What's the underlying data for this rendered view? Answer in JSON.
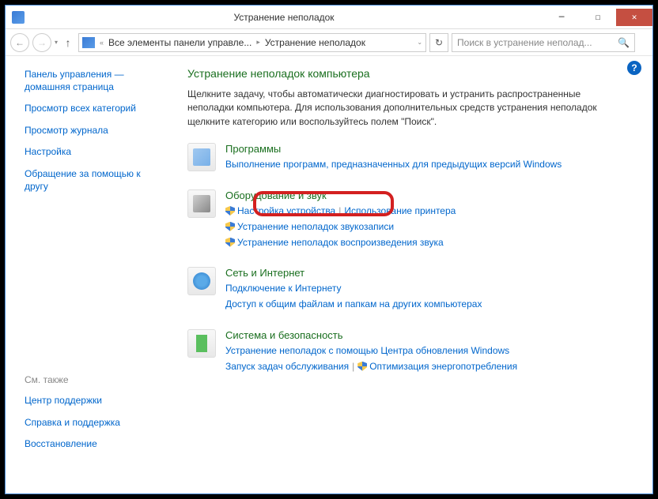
{
  "window": {
    "title": "Устранение неполадок"
  },
  "address": {
    "seg1": "Все элементы панели управле...",
    "seg2": "Устранение неполадок"
  },
  "search": {
    "placeholder": "Поиск в устранение неполад..."
  },
  "sidebar": {
    "home": "Панель управления — домашняя страница",
    "links": [
      "Просмотр всех категорий",
      "Просмотр журнала",
      "Настройка",
      "Обращение за помощью к другу"
    ],
    "seealso_header": "См. также",
    "seealso": [
      "Центр поддержки",
      "Справка и поддержка",
      "Восстановление"
    ]
  },
  "main": {
    "heading": "Устранение неполадок компьютера",
    "intro": "Щелкните задачу, чтобы автоматически диагностировать и устранить распространенные неполадки компьютера. Для использования дополнительных средств устранения неполадок щелкните категорию или воспользуйтесь полем \"Поиск\".",
    "cats": {
      "programs": {
        "title": "Программы",
        "sub1": "Выполнение программ, предназначенных для предыдущих версий Windows"
      },
      "hardware": {
        "title": "Оборудование и звук",
        "sub1": "Настройка устройства",
        "sub2": "Использование принтера",
        "sub3": "Устранение неполадок звукозаписи",
        "sub4": "Устранение неполадок воспроизведения звука"
      },
      "network": {
        "title": "Сеть и Интернет",
        "sub1": "Подключение к Интернету",
        "sub2": "Доступ к общим файлам и папкам на других компьютерах"
      },
      "system": {
        "title": "Система и безопасность",
        "sub1": "Устранение неполадок с помощью Центра обновления Windows",
        "sub2": "Запуск задач обслуживания",
        "sub3": "Оптимизация энергопотребления"
      }
    }
  }
}
